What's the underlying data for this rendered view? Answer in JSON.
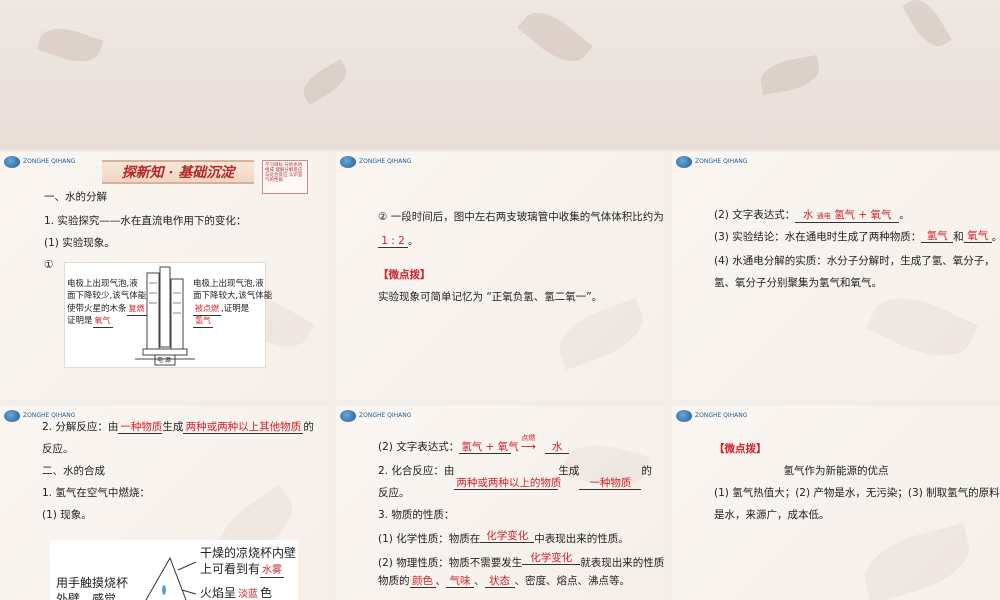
{
  "logo": {
    "text": "ZONGHE QIHANG"
  },
  "slide1": {
    "banner": "探新知 · 基础沉淀",
    "note": "学习目标 分析水的组成 理解分解反应与化合反应 认识氢气的性质",
    "h1": "一、水的分解",
    "l1": "1. 实验探究——水在直流电作用下的变化：",
    "l2": "(1) 实验现象。",
    "l3": "①",
    "fig_left_1": "电极上出现气泡,液",
    "fig_left_2": "面下降较少,该气体能",
    "fig_left_3": "使带火星的木条",
    "fig_left_3_ans": "复燃",
    "fig_left_4": "证明是",
    "fig_left_4_ans": "氧气",
    "fig_right_1": "电极上出现气泡,液",
    "fig_right_2": "面下降较大,该气体能",
    "fig_right_3_ans": "被点燃",
    "fig_right_3": ",证明是",
    "fig_right_4_ans": "氢气",
    "fig_bottom": "电 源"
  },
  "slide2": {
    "l1": "② 一段时间后，图中左右两支玻璃管中收集的气体体积比约为",
    "ratio": "1 : 2",
    "l2_end": "。",
    "tip": "【微点拨】",
    "tip_text": "实验现象可简单记忆为 “正氧负氢、氢二氧一”。"
  },
  "slide3": {
    "l1_pre": "(2) 文字表达式：",
    "l1_ans_a": "水",
    "l1_cond": "通电",
    "l1_ans_b": "氢气 + 氧气",
    "l1_end": "。",
    "l2_pre": "(3) 实验结论：水在通电时生成了两种物质：",
    "l2_ans_a": "氢气",
    "l2_mid": "和",
    "l2_ans_b": "氧气",
    "l2_end": "。",
    "l3": "(4) 水通电分解的实质：水分子分解时，生成了氢、氧分子，",
    "l4": "氢、氧分子分别聚集为氢气和氧气。"
  },
  "slide4": {
    "l1_pre": "2. 分解反应：由",
    "l1_ans_a": "一种物质",
    "l1_mid": "生成",
    "l1_ans_b": "两种或两种以上其他物质",
    "l1_end": "的",
    "l2": "反应。",
    "h2": "二、水的合成",
    "l3": "1. 氢气在空气中燃烧：",
    "l4": "(1) 现象。",
    "fig_top_1": "干燥的凉烧杯内壁",
    "fig_top_2": "上可看到有",
    "fig_top_ans": "水雾",
    "fig_left": "用手触摸烧杯",
    "fig_left_2": "外壁，感觉",
    "fig_mid": "火焰呈",
    "fig_mid_ans": "淡蓝",
    "fig_mid_end": "色"
  },
  "slide5": {
    "l1_pre": "(2) 文字表达式：",
    "l1_ans_a": "氢气 + 氧气",
    "l1_cond": "点燃",
    "l1_ans_b": "水",
    "l2_pre": "2. 化合反应：由",
    "l2_ans_a": "两种或两种以上的物质",
    "l2_mid": "生成",
    "l2_ans_b": "一种物质",
    "l2_end": "的",
    "l3": "反应。",
    "l4": "3. 物质的性质：",
    "l5_pre": "(1) 化学性质：物质在",
    "l5_ans": "化学变化",
    "l5_end": "中表现出来的性质。",
    "l6_pre": "(2) 物理性质：物质不需要发生",
    "l6_ans": "化学变化",
    "l6_end": "就表现出来的性质，如",
    "l7_pre": "物质的",
    "l7_a": "颜色",
    "l7_b": "气味",
    "l7_c": "状态",
    "l7_end": "、密度、熔点、沸点等。"
  },
  "slide6": {
    "tip": "【微点拨】",
    "title": "氢气作为新能源的优点",
    "l1": "(1) 氢气热值大；(2) 产物是水，无污染；(3) 制取氢气的原料",
    "l2": "是水，来源广，成本低。"
  }
}
